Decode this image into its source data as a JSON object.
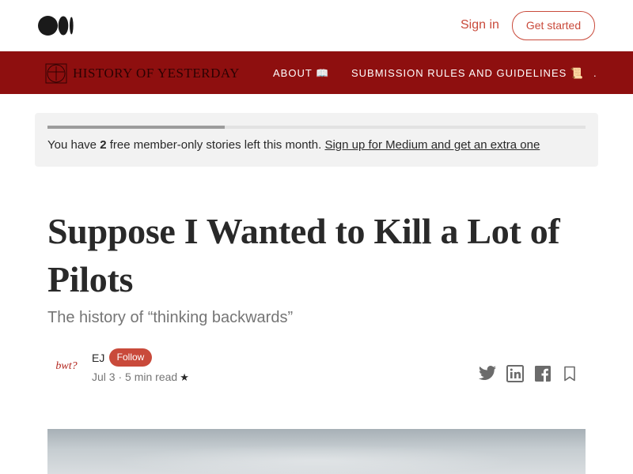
{
  "topbar": {
    "logo_icon": "medium-logo-icon",
    "signin_label": "Sign in",
    "get_started_label": "Get started"
  },
  "publication": {
    "name": "HISTORY OF YESTERDAY",
    "nav": [
      {
        "label": "ABOUT 📖"
      },
      {
        "label": "SUBMISSION RULES AND GUIDELINES 📜"
      },
      {
        "label": "."
      }
    ]
  },
  "notice": {
    "prefix": "You have ",
    "count": "2",
    "suffix": " free member-only stories left this month. ",
    "link": "Sign up for Medium and get an extra one",
    "progress_fraction": 0.33
  },
  "article": {
    "title": "Suppose I Wanted to Kill a Lot of Pilots",
    "subtitle": "The history of “thinking backwards”",
    "author": {
      "avatar_text": "bwt?",
      "name": "EJ",
      "follow_label": "Follow",
      "date": "Jul 3",
      "separator": " · ",
      "read_time": "5 min read",
      "member_icon": "★"
    },
    "share_icons": [
      "twitter-icon",
      "linkedin-icon",
      "facebook-icon",
      "bookmark-icon"
    ]
  },
  "colors": {
    "accent": "#c94a3b",
    "publication_bar": "#8e0f0f",
    "notice_bg": "#f2f2f2"
  }
}
